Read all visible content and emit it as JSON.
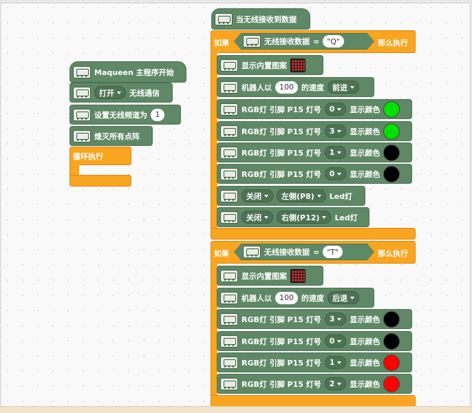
{
  "left_stack": {
    "start": "Maqueen 主程序开始",
    "radio_state": "打开",
    "radio_label": "无线通信",
    "set_channel": "设置无线频道为",
    "channel": "1",
    "clear_matrix": "熄灭所有点阵",
    "forever": "循环执行"
  },
  "event": {
    "label": "当无线接收到数据"
  },
  "if1": {
    "label": "如果",
    "cond_label": "无线接收数据",
    "op": "=",
    "value": "\"Q\"",
    "then": "那么执行",
    "show_pattern": "显示内置图案",
    "speed_prefix": "机器人以",
    "speed": "100",
    "speed_suffix": "的速度",
    "direction": "前进",
    "rgb": [
      {
        "text": "RGB灯 引脚 P15 灯号",
        "num": "0",
        "show": "显示颜色",
        "color": "#00e000"
      },
      {
        "text": "RGB灯 引脚 P15 灯号",
        "num": "3",
        "show": "显示颜色",
        "color": "#00e000"
      },
      {
        "text": "RGB灯 引脚 P15 灯号",
        "num": "1",
        "show": "显示颜色",
        "color": "#000000"
      },
      {
        "text": "RGB灯 引脚 P15 灯号",
        "num": "0",
        "show": "显示颜色",
        "color": "#000000"
      }
    ],
    "led": [
      {
        "state": "关闭",
        "side": "左侧(P8)",
        "suffix": "Led灯"
      },
      {
        "state": "关闭",
        "side": "右侧(P12)",
        "suffix": "Led灯"
      }
    ]
  },
  "if2": {
    "label": "如果",
    "cond_label": "无线接收数据",
    "op": "=",
    "value": "\"T\"",
    "then": "那么执行",
    "show_pattern": "显示内置图案",
    "speed_prefix": "机器人以",
    "speed": "100",
    "speed_suffix": "的速度",
    "direction": "后退",
    "rgb": [
      {
        "text": "RGB灯 引脚 P15 灯号",
        "num": "3",
        "show": "显示颜色",
        "color": "#000000"
      },
      {
        "text": "RGB灯 引脚 P15 灯号",
        "num": "0",
        "show": "显示颜色",
        "color": "#000000"
      },
      {
        "text": "RGB灯 引脚 P15 灯号",
        "num": "1",
        "show": "显示颜色",
        "color": "#ff0000"
      },
      {
        "text": "RGB灯 引脚 P15 灯号",
        "num": "2",
        "show": "显示颜色",
        "color": "#ff0000"
      }
    ]
  },
  "colors": {
    "block_green": "#5f8866",
    "block_orange": "#f9a51f"
  }
}
